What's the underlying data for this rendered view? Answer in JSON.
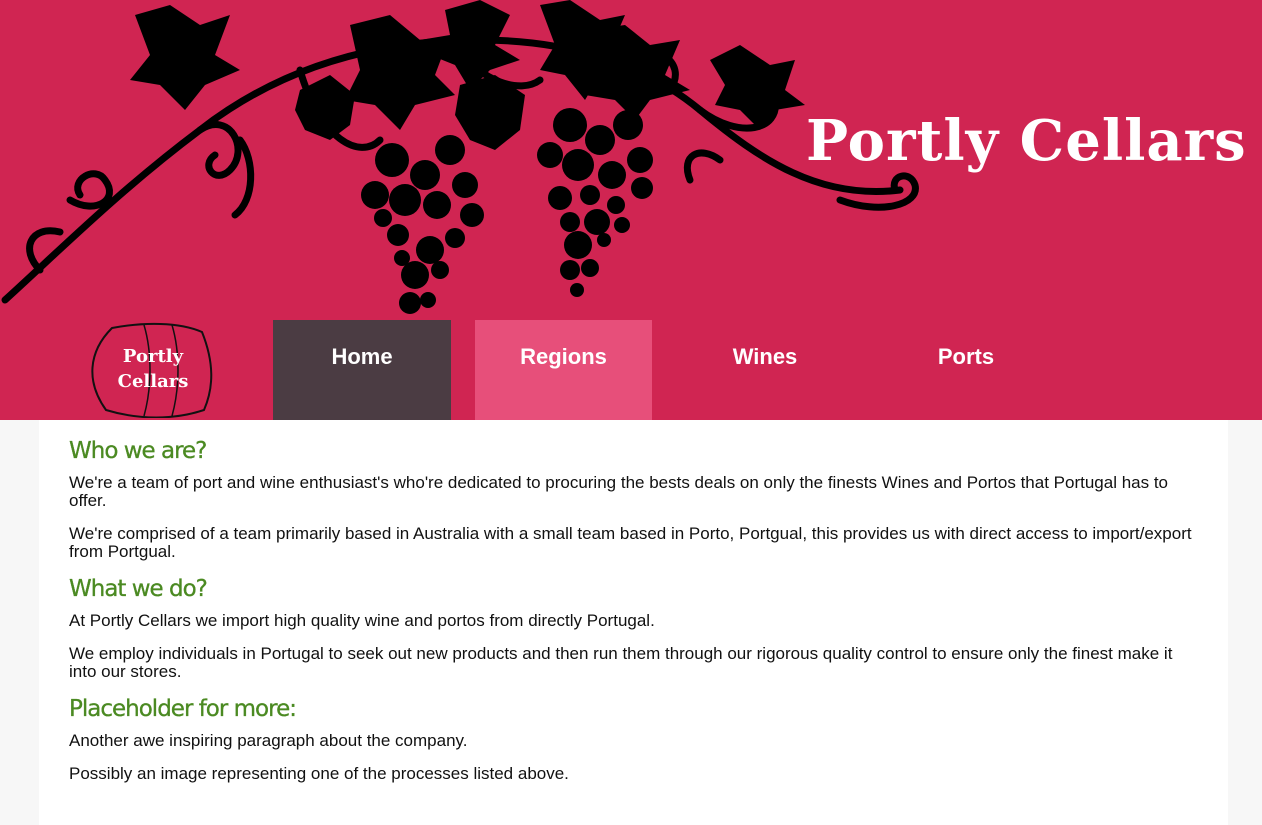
{
  "header": {
    "site_title": "Portly Cellars",
    "logo_text_line1": "Portly",
    "logo_text_line2": "Cellars"
  },
  "nav": {
    "items": [
      {
        "label": "Home",
        "state": "active"
      },
      {
        "label": "Regions",
        "state": "hover"
      },
      {
        "label": "Wines",
        "state": "default"
      },
      {
        "label": "Ports",
        "state": "default"
      }
    ]
  },
  "sections": [
    {
      "heading": "Who we are?",
      "paragraphs": [
        "We're a team of port and wine enthusiast's who're dedicated to procuring the bests deals on only the finests Wines and Portos that Portugal has to offer.",
        "We're comprised of a team primarily based in Australia with a small team based in Porto, Portgual, this provides us with direct access to import/export from Portgual."
      ]
    },
    {
      "heading": "What we do?",
      "paragraphs": [
        "At Portly Cellars we import high quality wine and portos from directly Portugal.",
        "We employ individuals in Portugal to seek out new products and then run them through our rigorous quality control to ensure only the finest make it into our stores."
      ]
    },
    {
      "heading": "Placeholder for more:",
      "paragraphs": [
        "Another awe inspiring paragraph about the company.",
        "Possibly an image representing one of the processes listed above."
      ]
    }
  ],
  "colors": {
    "header_bg": "#d02552",
    "nav_active": "#4b3c43",
    "nav_hover": "#e74f7a",
    "heading": "#4b8a22"
  }
}
